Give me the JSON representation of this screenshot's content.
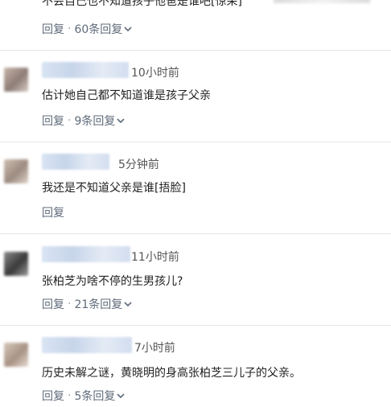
{
  "comments": [
    {
      "text": "不会自己也不知道孩子他爸是谁吧[惊呆]",
      "reply_label": "回复",
      "sep": "·",
      "reply_count": "60条回复"
    },
    {
      "time": "10小时前",
      "text": "估计她自己都不知道谁是孩子父亲",
      "reply_label": "回复",
      "sep": "·",
      "reply_count": "9条回复"
    },
    {
      "time": "5分钟前",
      "text": "我还是不知道父亲是谁[捂脸]",
      "reply_label": "回复"
    },
    {
      "time": "11小时前",
      "text": "张柏芝为啥不停的生男孩儿?",
      "reply_label": "回复",
      "sep": "·",
      "reply_count": "21条回复"
    },
    {
      "time": "7小时前",
      "text": "历史未解之谜，黄晓明的身高张柏芝三儿子的父亲。",
      "reply_label": "回复",
      "sep": "·",
      "reply_count": "5条回复"
    }
  ],
  "icons": {
    "expand": "chevron-down-icon"
  },
  "colors": {
    "reply": "#5f6b7a",
    "text": "#222222",
    "divider": "#e6e6e6"
  }
}
